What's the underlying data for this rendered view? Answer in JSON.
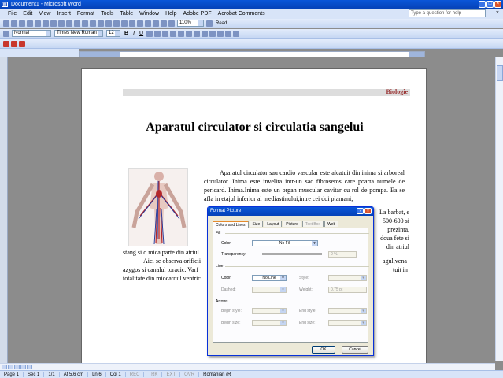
{
  "window": {
    "title": "Document1 - Microsoft Word"
  },
  "menu": [
    "File",
    "Edit",
    "View",
    "Insert",
    "Format",
    "Tools",
    "Table",
    "Window",
    "Help",
    "Adobe PDF",
    "Acrobat Comments"
  ],
  "help_box": "Type a question for help",
  "toolbar": {
    "zoom": "110%",
    "read_label": "Read",
    "style": "Normal",
    "font": "Times New Roman",
    "size": "12",
    "bold": "B",
    "italic": "I",
    "underline": "U"
  },
  "document": {
    "header_text": "Biologie",
    "title": "Aparatul circulator si circulatia sangelui",
    "para1": "Aparatul circulator sau cardio vascular este alcatuit din inima si arboreal circulator. Inima este invelita intr-un sac fibroseros care poarta numele de pericard. Inima.Inima este un organ muscular cavitar cu rol de pompa. Ea se afla in etajul inferior al mediastinului,intre cei doi plamani,",
    "para2": "La barbat, e 500-600 si prezinta, doua fete si din atriul",
    "para3a": "stang si o mica parte din atriul",
    "para3b": "Aici se observa orificii",
    "para3b_tail": "agul,vena",
    "para3c": "azygos si canalul toracic. Varf",
    "para3c_tail": "tuit in",
    "para3d": "totalitate din miocardul ventric"
  },
  "dialog": {
    "title": "Format Picture",
    "tabs": [
      "Colors and Lines",
      "Size",
      "Layout",
      "Picture",
      "Text Box",
      "Web"
    ],
    "fill_group": "Fill",
    "color_label": "Color:",
    "fill_color_value": "No Fill",
    "transparency_label": "Transparency:",
    "transparency_value": "0 %",
    "line_group": "Line",
    "line_color_label": "Color:",
    "line_color_value": "No Line",
    "style_label": "Style:",
    "dashed_label": "Dashed:",
    "weight_label": "Weight:",
    "weight_value": "0,75 pt",
    "arrows_group": "Arrows",
    "begin_style_label": "Begin style:",
    "end_style_label": "End style:",
    "begin_size_label": "Begin size:",
    "end_size_label": "End size:",
    "ok_label": "OK",
    "cancel_label": "Cancel"
  },
  "status": {
    "page": "Page 1",
    "sec": "Sec 1",
    "pages": "1/1",
    "at": "At 5,6 cm",
    "ln": "Ln 6",
    "col": "Col 1",
    "rec": "REC",
    "trk": "TRK",
    "ext": "EXT",
    "ovr": "OVR",
    "lang": "Romanian (R"
  },
  "colors": {
    "title_blue": "#0a56d8",
    "accent_orange": "#e68b2c",
    "header_red": "#993333"
  }
}
